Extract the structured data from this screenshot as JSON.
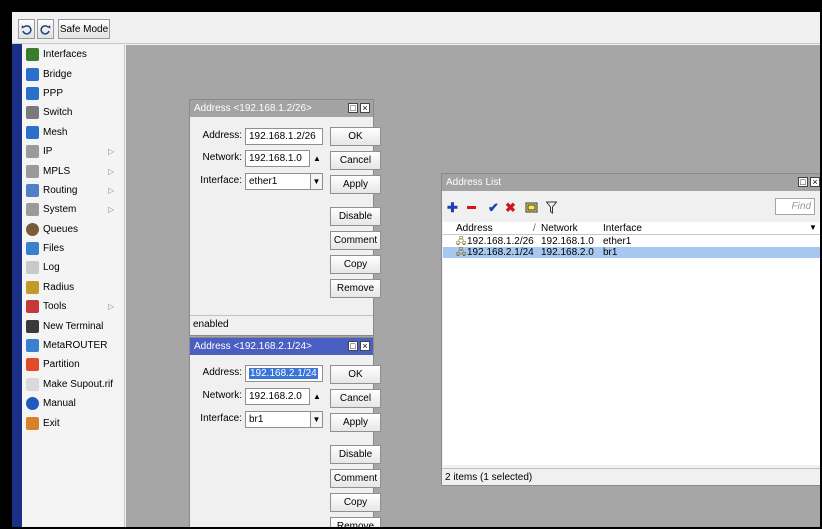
{
  "toolbar": {
    "undo_icon": "undo-icon",
    "redo_icon": "redo-icon",
    "safe_mode_label": "Safe Mode"
  },
  "sidebar": {
    "items": [
      {
        "label": "Interfaces",
        "icon": "interfaces-icon",
        "submenu": false
      },
      {
        "label": "Bridge",
        "icon": "bridge-icon",
        "submenu": false
      },
      {
        "label": "PPP",
        "icon": "ppp-icon",
        "submenu": false
      },
      {
        "label": "Switch",
        "icon": "switch-icon",
        "submenu": false
      },
      {
        "label": "Mesh",
        "icon": "mesh-icon",
        "submenu": false
      },
      {
        "label": "IP",
        "icon": "ip-icon",
        "submenu": true
      },
      {
        "label": "MPLS",
        "icon": "mpls-icon",
        "submenu": true
      },
      {
        "label": "Routing",
        "icon": "routing-icon",
        "submenu": true
      },
      {
        "label": "System",
        "icon": "system-icon",
        "submenu": true
      },
      {
        "label": "Queues",
        "icon": "queues-icon",
        "submenu": false
      },
      {
        "label": "Files",
        "icon": "files-icon",
        "submenu": false
      },
      {
        "label": "Log",
        "icon": "log-icon",
        "submenu": false
      },
      {
        "label": "Radius",
        "icon": "radius-icon",
        "submenu": false
      },
      {
        "label": "Tools",
        "icon": "tools-icon",
        "submenu": true
      },
      {
        "label": "New Terminal",
        "icon": "terminal-icon",
        "submenu": false
      },
      {
        "label": "MetaROUTER",
        "icon": "metarouter-icon",
        "submenu": false
      },
      {
        "label": "Partition",
        "icon": "partition-icon",
        "submenu": false
      },
      {
        "label": "Make Supout.rif",
        "icon": "supout-icon",
        "submenu": false
      },
      {
        "label": "Manual",
        "icon": "manual-icon",
        "submenu": false
      },
      {
        "label": "Exit",
        "icon": "exit-icon",
        "submenu": false
      }
    ]
  },
  "address_window_1": {
    "title": "Address <192.168.1.2/26>",
    "address_label": "Address:",
    "address_value": "192.168.1.2/26",
    "network_label": "Network:",
    "network_value": "192.168.1.0",
    "interface_label": "Interface:",
    "interface_value": "ether1",
    "buttons": {
      "ok": "OK",
      "cancel": "Cancel",
      "apply": "Apply",
      "disable": "Disable",
      "comment": "Comment",
      "copy": "Copy",
      "remove": "Remove"
    },
    "status": "enabled"
  },
  "address_window_2": {
    "title": "Address <192.168.2.1/24>",
    "address_label": "Address:",
    "address_value": "192.168.2.1/24",
    "network_label": "Network:",
    "network_value": "192.168.2.0",
    "interface_label": "Interface:",
    "interface_value": "br1",
    "buttons": {
      "ok": "OK",
      "cancel": "Cancel",
      "apply": "Apply",
      "disable": "Disable",
      "comment": "Comment",
      "copy": "Copy",
      "remove": "Remove"
    }
  },
  "address_list": {
    "title": "Address List",
    "find_placeholder": "Find",
    "columns": [
      "Address",
      "Network",
      "Interface"
    ],
    "sort_marker": "/",
    "rows": [
      {
        "address": "192.168.1.2/26",
        "network": "192.168.1.0",
        "interface": "ether1",
        "selected": false
      },
      {
        "address": "192.168.2.1/24",
        "network": "192.168.2.0",
        "interface": "br1",
        "selected": true
      }
    ],
    "status": "2 items (1 selected)"
  },
  "colors": {
    "active_title": "#4a5fc1",
    "inactive_title": "#a3a3a3",
    "selection": "#a6c8f0",
    "desktop": "#a6a6a6"
  }
}
